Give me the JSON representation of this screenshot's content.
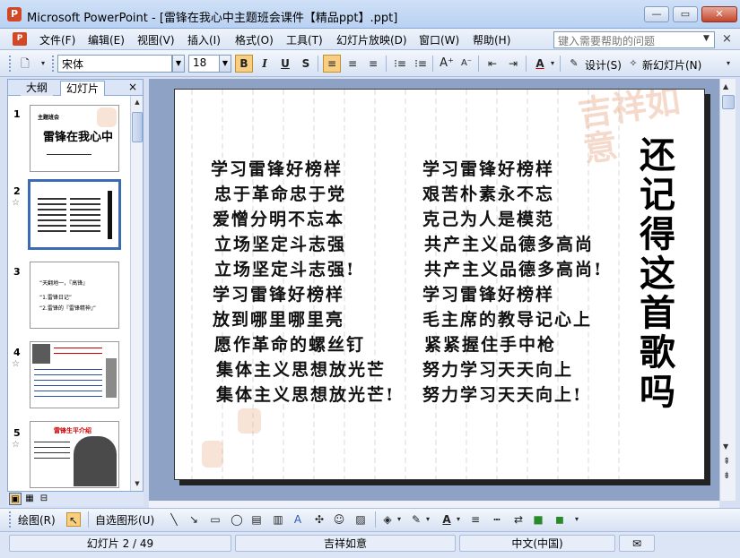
{
  "window": {
    "title": "Microsoft PowerPoint - [雷锋在我心中主题班会课件【精品ppt】.ppt]",
    "minimize": "—",
    "maximize": "▭",
    "close": "✕"
  },
  "menu": {
    "items": [
      "文件(F)",
      "编辑(E)",
      "视图(V)",
      "插入(I)",
      "格式(O)",
      "工具(T)",
      "幻灯片放映(D)",
      "窗口(W)",
      "帮助(H)"
    ],
    "help_placeholder": "键入需要帮助的问题"
  },
  "toolbar": {
    "font_name": "宋体",
    "font_size": "18",
    "bold": "B",
    "italic": "I",
    "underline": "U",
    "shadow": "S",
    "design_label": "设计(S)",
    "new_slide_label": "新幻灯片(N)"
  },
  "panel": {
    "tab_outline": "大纲",
    "tab_slides": "幻灯片",
    "close": "×",
    "slides": [
      {
        "num": "1",
        "title_small": "主题班会",
        "title_big": "雷锋在我心中"
      },
      {
        "num": "2",
        "star": "☆"
      },
      {
        "num": "3",
        "lines": [
          "“天翻地一，『高锋』",
          "“1.雷锋日记”",
          "“2.雷锋的『雷锋精神』”"
        ]
      },
      {
        "num": "4",
        "star": "☆",
        "side_text": "雷锋简介"
      },
      {
        "num": "5",
        "star": "☆",
        "title_red": "雷锋生平介绍"
      }
    ]
  },
  "slide": {
    "left_column": [
      "学习雷锋好榜样",
      "忠于革命忠于党",
      "爱憎分明不忘本",
      "立场坚定斗志强",
      "立场坚定斗志强!",
      "学习雷锋好榜样",
      "放到哪里哪里亮",
      "愿作革命的螺丝钉",
      "集体主义思想放光芒",
      "集体主义思想放光芒!"
    ],
    "right_column": [
      "学习雷锋好榜样",
      "艰苦朴素永不忘",
      "克己为人是模范",
      "共产主义品德多高尚",
      "共产主义品德多高尚!",
      "学习雷锋好榜样",
      "毛主席的教导记心上",
      "紧紧握住手中枪",
      "努力学习天天向上",
      "努力学习天天向上!"
    ],
    "vertical_title": [
      "还",
      "记",
      "得",
      "这",
      "首",
      "歌",
      "吗"
    ],
    "seal_text": "吉祥如意"
  },
  "drawbar": {
    "draw_label": "绘图(R)",
    "autoshapes_label": "自选图形(U)"
  },
  "status": {
    "slide_info": "幻灯片 2 / 49",
    "design_name": "吉祥如意",
    "language": "中文(中国)"
  }
}
